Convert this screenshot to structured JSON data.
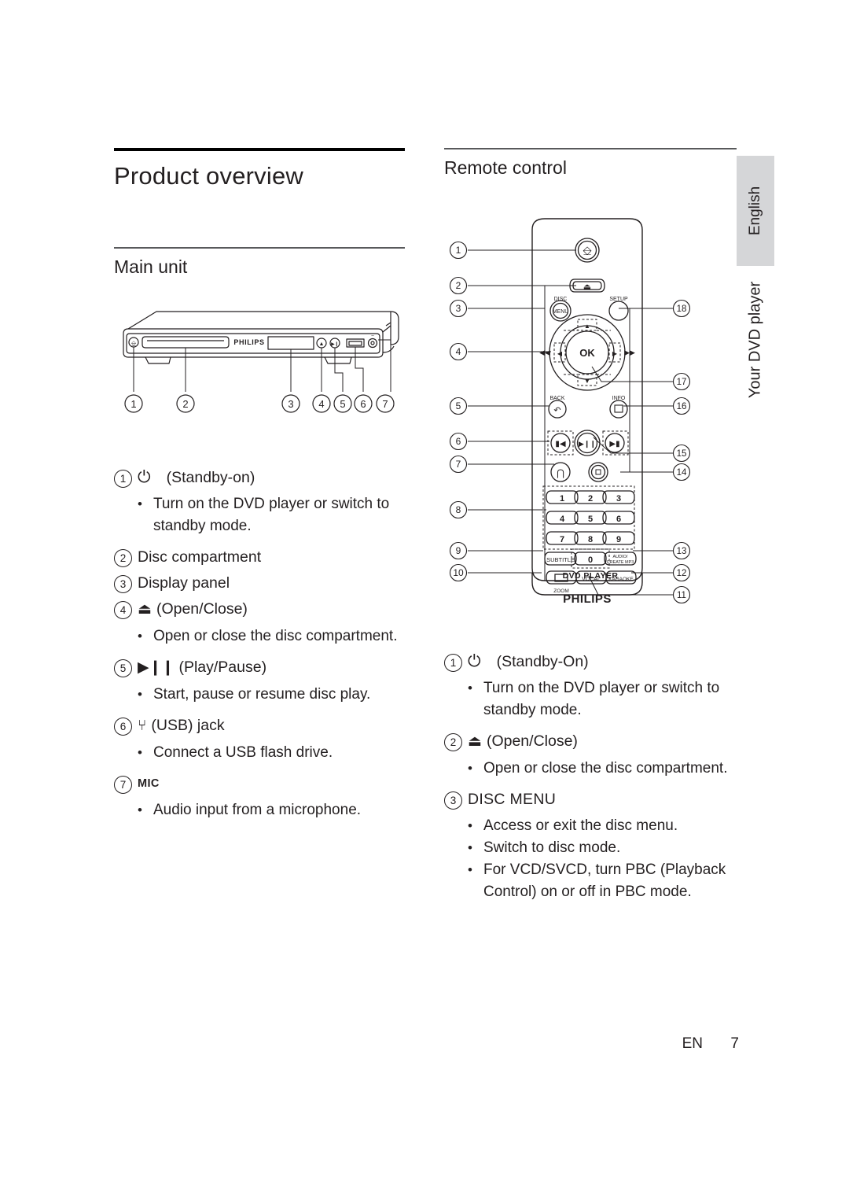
{
  "page": {
    "footer_lang": "EN",
    "footer_page": "7",
    "side_tab": "English",
    "side_running_head": "Your DVD player"
  },
  "left_column": {
    "chapter_title": "Product overview",
    "section_title": "Main unit",
    "figure": {
      "name": "main-unit-diagram",
      "brand": "PHILIPS",
      "callouts": [
        "1",
        "2",
        "3",
        "4",
        "5",
        "6",
        "7"
      ]
    },
    "items": [
      {
        "num": "1",
        "icon": "power-standby-icon",
        "glyph": "⏻",
        "label": "(Standby-on)",
        "bullets": [
          "Turn on the DVD player or switch to standby mode."
        ]
      },
      {
        "num": "2",
        "icon": "",
        "glyph": "",
        "label": "Disc compartment",
        "bullets": []
      },
      {
        "num": "3",
        "icon": "",
        "glyph": "",
        "label": "Display panel",
        "bullets": []
      },
      {
        "num": "4",
        "icon": "eject-open-close-icon",
        "glyph": "⏏",
        "label": "(Open/Close)",
        "bullets": [
          "Open or close the disc compartment."
        ]
      },
      {
        "num": "5",
        "icon": "play-pause-icon",
        "glyph": "▶❙❙",
        "label": "(Play/Pause)",
        "bullets": [
          "Start, pause or resume disc play."
        ]
      },
      {
        "num": "6",
        "icon": "usb-icon",
        "glyph": "⑂",
        "label": "(USB) jack",
        "bullets": [
          "Connect a USB flash drive."
        ]
      },
      {
        "num": "7",
        "icon": "",
        "glyph": "",
        "label": "MIC",
        "bullets": [
          "Audio input from a microphone."
        ]
      }
    ]
  },
  "right_column": {
    "section_title": "Remote control",
    "figure": {
      "name": "remote-control-diagram",
      "brand": "PHILIPS",
      "brand_sub": "DVD PLAYER",
      "left_callouts": [
        "1",
        "2",
        "3",
        "4",
        "5",
        "6",
        "7",
        "8",
        "9",
        "10"
      ],
      "right_callouts": [
        "18",
        "17",
        "16",
        "15",
        "14",
        "13",
        "12",
        "11"
      ],
      "button_labels": {
        "disc_menu_top": "DISC",
        "disc_menu_bottom": "MENU",
        "setup": "SETUP",
        "ok": "OK",
        "back": "BACK",
        "info": "INFO",
        "zoom": "ZOOM",
        "subtitle": "SUBTITLE",
        "audio_create_mp3_line1": "AUDIO/",
        "audio_create_mp3_line2": "CREATE MP3",
        "vocal": "VOCAL",
        "karaoke": "KARAOKE",
        "keypad": [
          "1",
          "2",
          "3",
          "4",
          "5",
          "6",
          "7",
          "8",
          "9",
          "0"
        ]
      }
    },
    "items": [
      {
        "num": "1",
        "icon": "power-standby-icon",
        "glyph": "⏻",
        "label": "(Standby-On)",
        "bullets": [
          "Turn on the DVD player or switch to standby mode."
        ]
      },
      {
        "num": "2",
        "icon": "eject-open-close-icon",
        "glyph": "⏏",
        "label": "(Open/Close)",
        "bullets": [
          "Open or close the disc compartment."
        ]
      },
      {
        "num": "3",
        "icon": "",
        "glyph": "",
        "label": "DISC MENU",
        "bullets": [
          "Access or exit the disc menu.",
          "Switch to disc mode.",
          "For VCD/SVCD, turn PBC (Playback Control) on or off in PBC mode."
        ]
      }
    ]
  },
  "colors": {
    "text": "#231f20",
    "rule_thick": "#000000",
    "rule_thin": "#58595b",
    "side_tab_bg": "#d5d6d8",
    "line_art": "#231f20"
  }
}
